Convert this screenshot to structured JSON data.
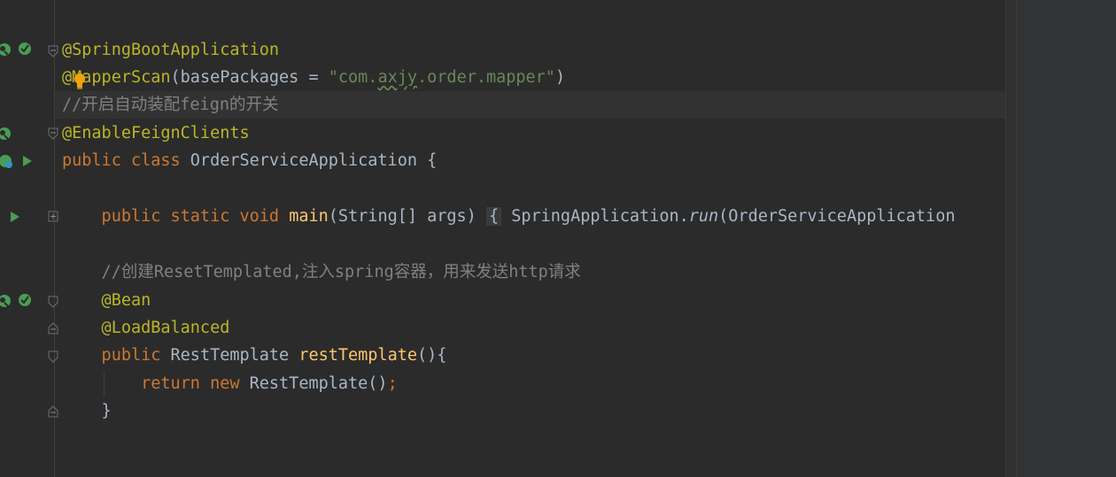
{
  "editor": {
    "lines": [
      {
        "id": "l1",
        "segments": [
          {
            "t": "@SpringBootApplication",
            "c": "ann"
          }
        ]
      },
      {
        "id": "l2",
        "segments": [
          {
            "t": "@MapperScan",
            "c": "ann"
          },
          {
            "t": "(basePackages = ",
            "c": "plain"
          },
          {
            "t": "\"com.",
            "c": "str"
          },
          {
            "t": "axjy",
            "c": "str-wavy"
          },
          {
            "t": ".order.mapper\"",
            "c": "str"
          },
          {
            "t": ")",
            "c": "plain"
          }
        ]
      },
      {
        "id": "l3",
        "segments": [
          {
            "t": "//开启自动装配feign的开关",
            "c": "cmt"
          }
        ]
      },
      {
        "id": "l4",
        "segments": [
          {
            "t": "@EnableFeignClients",
            "c": "ann"
          }
        ]
      },
      {
        "id": "l5",
        "segments": [
          {
            "t": "public class ",
            "c": "kw"
          },
          {
            "t": "OrderServiceApplication {",
            "c": "plain"
          }
        ]
      },
      {
        "id": "l6",
        "segments": [
          {
            "t": "    public static void ",
            "c": "kw"
          },
          {
            "t": "main",
            "c": "fn"
          },
          {
            "t": "(String[] args) ",
            "c": "plain"
          },
          {
            "t": "{",
            "c": "brace"
          },
          {
            "t": " SpringApplication.",
            "c": "plain"
          },
          {
            "t": "run",
            "c": "it"
          },
          {
            "t": "(OrderServiceApplication",
            "c": "plain"
          }
        ]
      },
      {
        "id": "l7",
        "segments": [
          {
            "t": "    //创建ResetTemplated,注入spring容器，用来发送http请求",
            "c": "cmt"
          }
        ]
      },
      {
        "id": "l8",
        "segments": [
          {
            "t": "    @Bean",
            "c": "ann"
          }
        ]
      },
      {
        "id": "l9",
        "segments": [
          {
            "t": "    @LoadBalanced",
            "c": "ann"
          }
        ]
      },
      {
        "id": "l10",
        "segments": [
          {
            "t": "    public ",
            "c": "kw"
          },
          {
            "t": "RestTemplate ",
            "c": "plain"
          },
          {
            "t": "restTemplate",
            "c": "fn"
          },
          {
            "t": "(){",
            "c": "plain"
          }
        ]
      },
      {
        "id": "l11",
        "segments": [
          {
            "t": "        return new ",
            "c": "kw"
          },
          {
            "t": "RestTemplate()",
            "c": "plain"
          },
          {
            "t": ";",
            "c": "kw"
          }
        ]
      },
      {
        "id": "l12",
        "segments": [
          {
            "t": "    }",
            "c": "plain"
          }
        ]
      }
    ]
  },
  "gutter_icons": [
    "bean-icon",
    "implemented-icon",
    "fold-icon",
    "run-icon",
    "bulb-icon"
  ],
  "colors": {
    "background": "#2b2b2b",
    "annotation": "#bbb529",
    "keyword": "#cc7832",
    "string": "#6a8759",
    "comment": "#808080",
    "function": "#ffc66d",
    "text": "#a9b7c6",
    "run": "#499c54"
  }
}
